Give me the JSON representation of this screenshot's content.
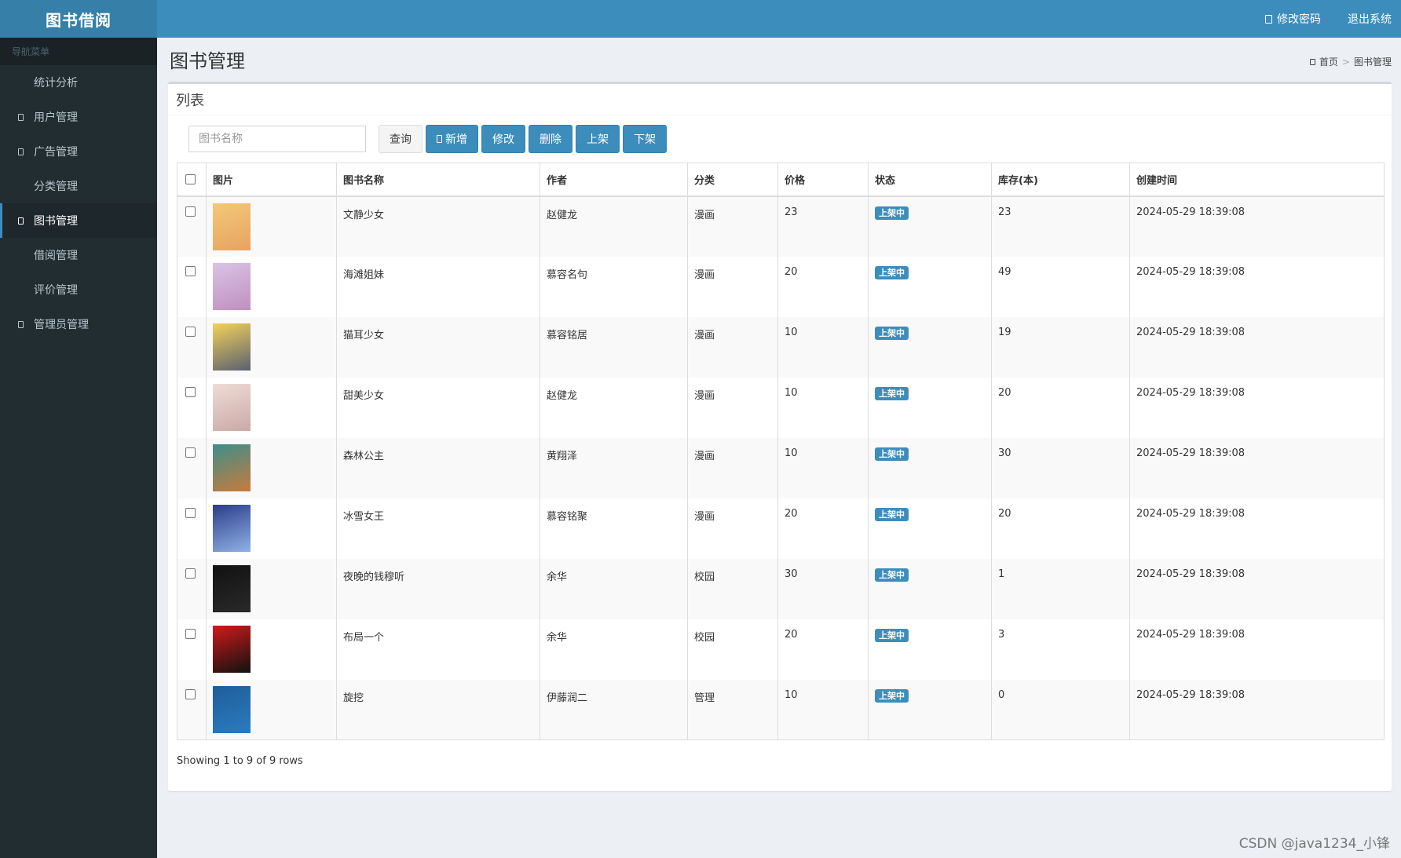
{
  "app": {
    "title": "图书借阅"
  },
  "header": {
    "change_password": "修改密码",
    "logout": "退出系统"
  },
  "sidebar": {
    "header": "导航菜单",
    "items": [
      {
        "label": "统计分析",
        "icon": "",
        "active": false
      },
      {
        "label": "用户管理",
        "icon": "user-icon",
        "active": false
      },
      {
        "label": "广告管理",
        "icon": "ad-icon",
        "active": false
      },
      {
        "label": "分类管理",
        "icon": "",
        "active": false
      },
      {
        "label": "图书管理",
        "icon": "book-icon",
        "active": true
      },
      {
        "label": "借阅管理",
        "icon": "",
        "active": false
      },
      {
        "label": "评价管理",
        "icon": "",
        "active": false
      },
      {
        "label": "管理员管理",
        "icon": "admin-icon",
        "active": false
      }
    ]
  },
  "page": {
    "title": "图书管理",
    "breadcrumb": {
      "home": "首页",
      "current": "图书管理"
    }
  },
  "box": {
    "title": "列表"
  },
  "toolbar": {
    "search_placeholder": "图书名称",
    "query": "查询",
    "add": "新增",
    "edit": "修改",
    "delete": "删除",
    "shelve": "上架",
    "unshelve": "下架"
  },
  "table": {
    "columns": [
      "图片",
      "图书名称",
      "作者",
      "分类",
      "价格",
      "状态",
      "库存(本)",
      "创建时间"
    ],
    "rows": [
      {
        "name": "文静少女",
        "author": "赵健龙",
        "category": "漫画",
        "price": "23",
        "status": "上架中",
        "stock": "23",
        "created": "2024-05-29 18:39:08",
        "cover_colors": [
          "#f2c978",
          "#e9a25f"
        ]
      },
      {
        "name": "海滩姐妹",
        "author": "慕容名句",
        "category": "漫画",
        "price": "20",
        "status": "上架中",
        "stock": "49",
        "created": "2024-05-29 18:39:08",
        "cover_colors": [
          "#d9c3e6",
          "#c08fbf"
        ]
      },
      {
        "name": "猫耳少女",
        "author": "慕容铭居",
        "category": "漫画",
        "price": "10",
        "status": "上架中",
        "stock": "19",
        "created": "2024-05-29 18:39:08",
        "cover_colors": [
          "#f3d25a",
          "#5a6070"
        ]
      },
      {
        "name": "甜美少女",
        "author": "赵健龙",
        "category": "漫画",
        "price": "10",
        "status": "上架中",
        "stock": "20",
        "created": "2024-05-29 18:39:08",
        "cover_colors": [
          "#f0dcd6",
          "#c9a9a6"
        ]
      },
      {
        "name": "森林公主",
        "author": "黄翔泽",
        "category": "漫画",
        "price": "10",
        "status": "上架中",
        "stock": "30",
        "created": "2024-05-29 18:39:08",
        "cover_colors": [
          "#3d8f8a",
          "#c97a3c"
        ]
      },
      {
        "name": "冰雪女王",
        "author": "慕容铭聚",
        "category": "漫画",
        "price": "20",
        "status": "上架中",
        "stock": "20",
        "created": "2024-05-29 18:39:08",
        "cover_colors": [
          "#2b3d8a",
          "#8fb2e6"
        ]
      },
      {
        "name": "夜晚的钱穆听",
        "author": "余华",
        "category": "校园",
        "price": "30",
        "status": "上架中",
        "stock": "1",
        "created": "2024-05-29 18:39:08",
        "cover_colors": [
          "#111111",
          "#2a2a2a"
        ]
      },
      {
        "name": "布局一个",
        "author": "余华",
        "category": "校园",
        "price": "20",
        "status": "上架中",
        "stock": "3",
        "created": "2024-05-29 18:39:08",
        "cover_colors": [
          "#d11a1a",
          "#111111"
        ]
      },
      {
        "name": "旋挖",
        "author": "伊藤润二",
        "category": "管理",
        "price": "10",
        "status": "上架中",
        "stock": "0",
        "created": "2024-05-29 18:39:08",
        "cover_colors": [
          "#1e5e9a",
          "#2c7bbf"
        ]
      }
    ]
  },
  "pager": {
    "summary": "Showing 1 to 9 of 9 rows"
  },
  "watermark": "CSDN @java1234_小锋",
  "colors": {
    "primary": "#3c8dbc",
    "sidebar": "#222d32",
    "logo": "#367fa9"
  }
}
